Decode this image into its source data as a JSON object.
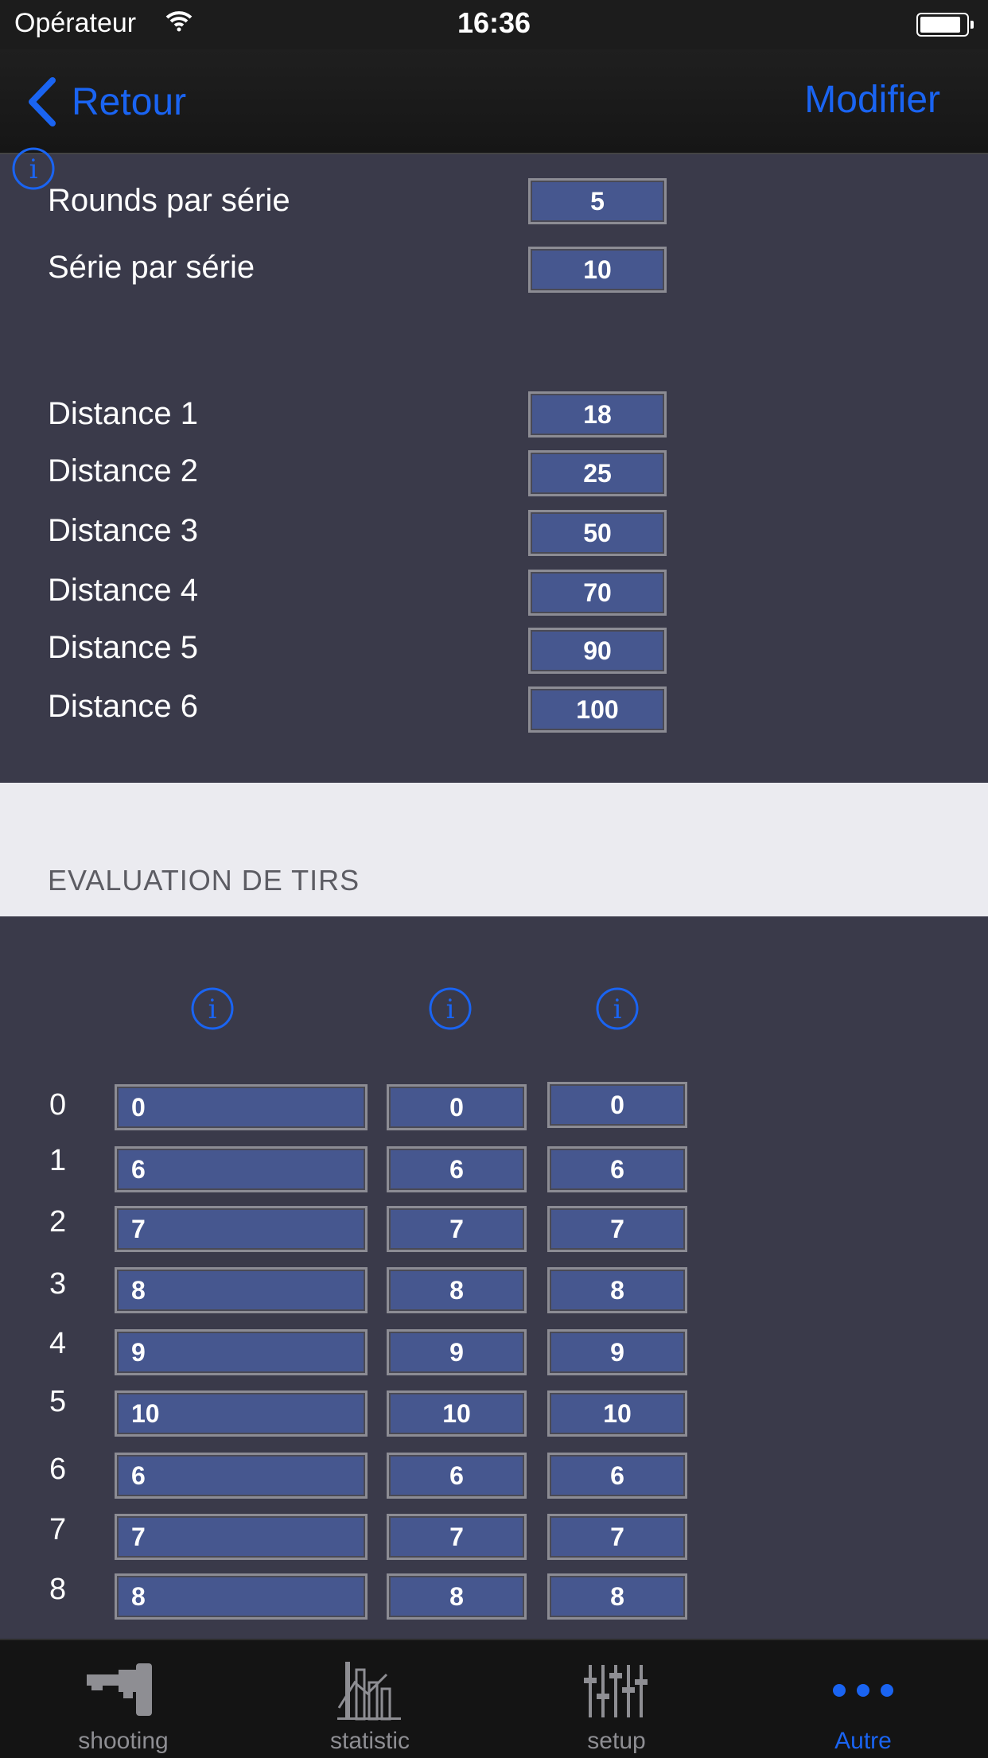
{
  "status_bar": {
    "carrier": "Opérateur",
    "time": "16:36"
  },
  "nav": {
    "back_label": "Retour",
    "edit_label": "Modifier"
  },
  "settings": {
    "rounds_label": "Rounds par série",
    "rounds_value": "5",
    "series_label": "Série par série",
    "series_value": "10",
    "distances": [
      {
        "label": "Distance 1",
        "value": "18"
      },
      {
        "label": "Distance 2",
        "value": "25"
      },
      {
        "label": "Distance 3",
        "value": "50"
      },
      {
        "label": "Distance 4",
        "value": "70"
      },
      {
        "label": "Distance 5",
        "value": "90"
      },
      {
        "label": "Distance 6",
        "value": "100"
      }
    ]
  },
  "evaluation": {
    "title": "EVALUATION DE TIRS",
    "rows": [
      {
        "num": "0",
        "v1": "0",
        "v2": "0",
        "v3": "0"
      },
      {
        "num": "1",
        "v1": "6",
        "v2": "6",
        "v3": "6"
      },
      {
        "num": "2",
        "v1": "7",
        "v2": "7",
        "v3": "7"
      },
      {
        "num": "3",
        "v1": "8",
        "v2": "8",
        "v3": "8"
      },
      {
        "num": "4",
        "v1": "9",
        "v2": "9",
        "v3": "9"
      },
      {
        "num": "5",
        "v1": "10",
        "v2": "10",
        "v3": "10"
      },
      {
        "num": "6",
        "v1": "6",
        "v2": "6",
        "v3": "6"
      },
      {
        "num": "7",
        "v1": "7",
        "v2": "7",
        "v3": "7"
      },
      {
        "num": "8",
        "v1": "8",
        "v2": "8",
        "v3": "8"
      }
    ]
  },
  "tabs": [
    {
      "label": "shooting",
      "icon": "pistol-icon"
    },
    {
      "label": "statistic",
      "icon": "statistic-icon"
    },
    {
      "label": "setup",
      "icon": "sliders-icon"
    },
    {
      "label": "Autre",
      "icon": "more-dots-icon"
    }
  ],
  "colors": {
    "accent": "#1a64f2",
    "panel": "#3a3a4a",
    "field": "#46578f"
  }
}
